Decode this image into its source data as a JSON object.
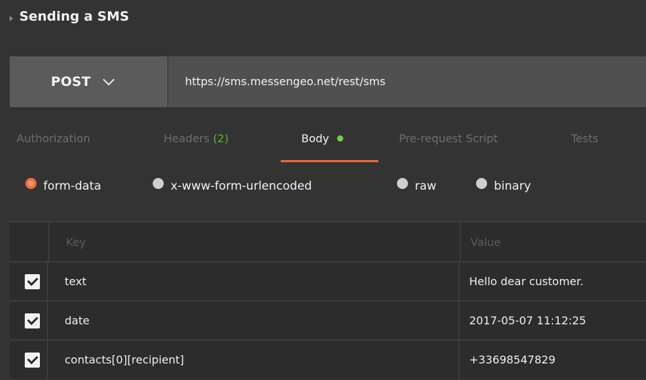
{
  "request": {
    "title": "Sending a SMS",
    "method": "POST",
    "url": "https://sms.messengeo.net/rest/sms"
  },
  "tabs": [
    {
      "label": "Authorization",
      "count": "",
      "active": false
    },
    {
      "label": "Headers",
      "count": "(2)",
      "active": false
    },
    {
      "label": "Body",
      "count": "",
      "active": true
    },
    {
      "label": "Pre-request Script",
      "count": "",
      "active": false
    },
    {
      "label": "Tests",
      "count": "",
      "active": false
    }
  ],
  "body_modes": [
    {
      "label": "form-data",
      "selected": true
    },
    {
      "label": "x-www-form-urlencoded",
      "selected": false
    },
    {
      "label": "raw",
      "selected": false
    },
    {
      "label": "binary",
      "selected": false
    }
  ],
  "table": {
    "key_header": "Key",
    "value_header": "Value",
    "rows": [
      {
        "key": "text",
        "value": "Hello dear customer.",
        "checked": true
      },
      {
        "key": "date",
        "value": "2017-05-07 11:12:25",
        "checked": true
      },
      {
        "key": "contacts[0][recipient]",
        "value": "+33698547829",
        "checked": true
      }
    ]
  },
  "colors": {
    "background": "#333333",
    "accent": "#f26b3a",
    "status_dot": "#6fd14a",
    "count": "#5eb32f"
  }
}
